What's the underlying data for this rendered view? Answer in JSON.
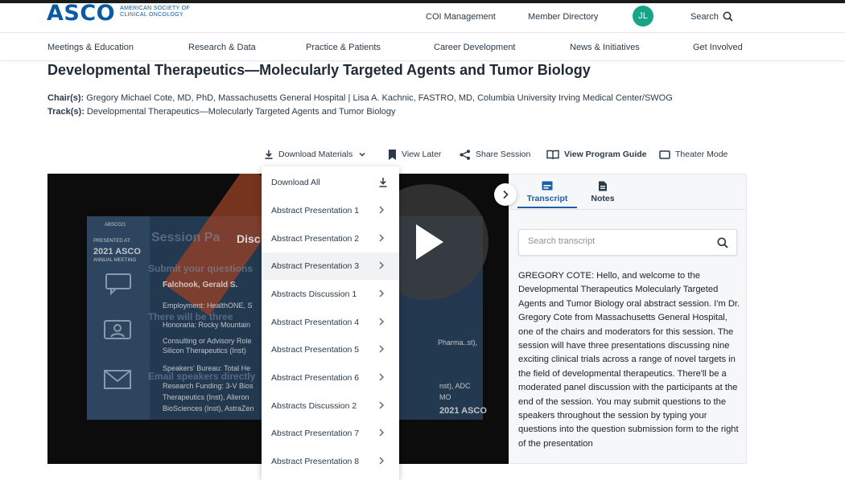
{
  "header": {
    "logo_text": "ASCO",
    "logo_sub_line1": "AMERICAN SOCIETY OF",
    "logo_sub_line2": "CLINICAL ONCOLOGY",
    "links": [
      "COI Management",
      "Member Directory"
    ],
    "avatar_initials": "JL",
    "search_label": "Search"
  },
  "nav": {
    "items": [
      "Meetings & Education",
      "Research & Data",
      "Practice & Patients",
      "Career Development",
      "News & Initiatives",
      "Get Involved"
    ]
  },
  "session": {
    "title": "Developmental Therapeutics—Molecularly Targeted Agents and Tumor Biology",
    "chair_label": "Chair(s):",
    "chair_value": "Gregory Michael Cote, MD, PhD, Massachusetts General Hospital | Lisa A. Kachnic, FASTRO, MD, Columbia University Irving Medical Center/SWOG",
    "track_label": "Track(s):",
    "track_value": "Developmental Therapeutics—Molecularly Targeted Agents and Tumor Biology"
  },
  "actions": {
    "download": "Download Materials",
    "view_later": "View Later",
    "share": "Share Session",
    "program_guide": "View Program Guide",
    "theater": "Theater Mode"
  },
  "dropdown": {
    "download_all": "Download All",
    "items": [
      "Abstract Presentation 1",
      "Abstract Presentation 2",
      "Abstract Presentation 3",
      "Abstracts Discussion 1",
      "Abstract Presentation 4",
      "Abstract Presentation 5",
      "Abstract Presentation 6",
      "Abstracts Discussion 2",
      "Abstract Presentation 7",
      "Abstract Presentation 8"
    ],
    "active_index": 2
  },
  "slide": {
    "badge": "ABSC021",
    "presented_at": "PRESENTED AT:",
    "year_logo": "2021 ASCO",
    "annual": "ANNUAL MEETING",
    "heading": "Session Pa",
    "heading2": "Disc",
    "speaker": "Falchook, Gerald S.",
    "employment": "Employment: HealthONE, S",
    "honoraria": "Honoraria: Rocky Mountain",
    "consulting": "Consulting or Advisory Role",
    "silicon": "Silicon Therapeutics (Inst)",
    "speakers_bureau": "Speakers' Bureau: Total He",
    "research": "Research Funding: 3-V Bios",
    "therapeutics": "Therapeutics (Inst), Alleron",
    "biosciences": "BioSciences (Inst), AstraZen",
    "ghost1": "Submit your questions",
    "ghost2": "There will be three",
    "ghost3": "Email speakers directly",
    "footer_logo": "2021 ASCO",
    "pharma": "Pharma..st),",
    "adc": "nst), ADC",
    "mo": "MO"
  },
  "panel": {
    "tabs": [
      "Transcript",
      "Notes"
    ],
    "active_tab": "Transcript",
    "search_placeholder": "Search transcript",
    "transcript_text": "GREGORY COTE: Hello, and welcome to the Developmental Therapeutics Molecularly Targeted Agents and Tumor Biology oral abstract session. I'm Dr. Gregory Cote from Massachusetts General Hospital, one of the chairs and moderators for this session. The session will have three presentations discussing nine exciting clinical trials across a range of novel targets in the field of developmental therapeutics. There'll be a moderated panel discussion with the participants at the end of the session. You may submit questions to the speakers throughout the session by typing your questions into the question submission form to the right of the presentation"
  },
  "colors": {
    "brand_blue": "#0b5aa6",
    "avatar_green": "#17a589",
    "tab_active": "#1a5fa8"
  }
}
